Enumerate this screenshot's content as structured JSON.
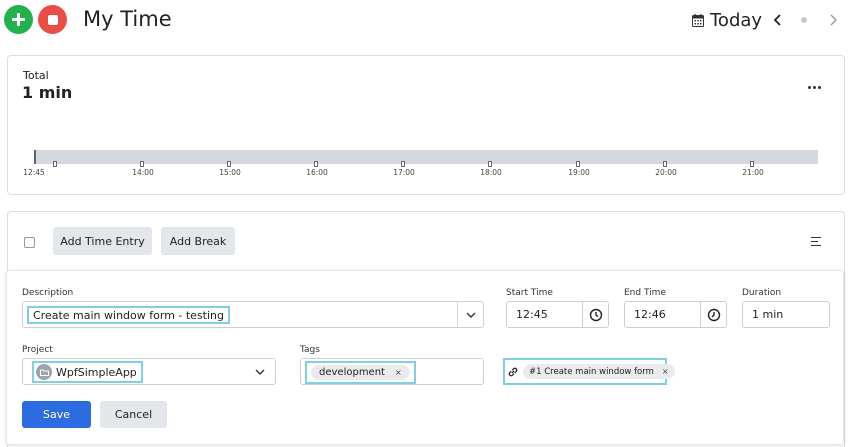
{
  "header": {
    "title": "My Time",
    "date_label": "Today",
    "add_icon": "plus-icon",
    "stop_icon": "stop-icon"
  },
  "summary": {
    "total_label": "Total",
    "total_value": "1 min",
    "timeline_ticks": [
      "12:45",
      "14:00",
      "15:00",
      "16:00",
      "17:00",
      "18:00",
      "19:00",
      "20:00",
      "21:00"
    ]
  },
  "toolbar": {
    "add_time_entry": "Add Time Entry",
    "add_break": "Add Break"
  },
  "form": {
    "description_label": "Description",
    "description_value": "Create main window form - testing",
    "start_time_label": "Start Time",
    "start_time_value": "12:45",
    "end_time_label": "End Time",
    "end_time_value": "12:46",
    "duration_label": "Duration",
    "duration_value": "1 min",
    "project_label": "Project",
    "project_value": "WpfSimpleApp",
    "tags_label": "Tags",
    "tags": [
      "development"
    ],
    "linked_item": "#1 Create main window form",
    "remove_glyph": "×",
    "save_label": "Save",
    "cancel_label": "Cancel"
  },
  "colors": {
    "add": "#23b14d",
    "stop": "#ea4d46",
    "primary": "#2d6ce0",
    "highlight": "#7fd0e0"
  }
}
